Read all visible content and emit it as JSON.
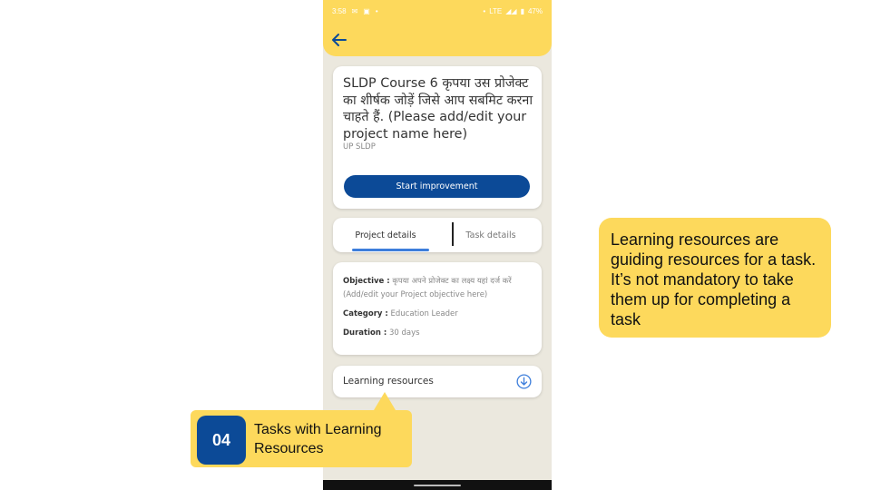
{
  "status_bar": {
    "time": "3:58",
    "battery": "47%",
    "network": "LTE"
  },
  "project": {
    "title": "SLDP Course 6 कृपया उस प्रोजेक्ट का शीर्षक जोड़ें जिसे आप सबमिट करना चाहते हैं. (Please add/edit your project name here)",
    "subtitle": "UP SLDP",
    "start_button": "Start improvement"
  },
  "tabs": {
    "project_details": "Project details",
    "task_details": "Task details"
  },
  "details": {
    "objective_label": "Objective :",
    "objective_value": " कृपया अपने प्रोजेक्ट का लक्ष्य यहां दर्ज करें (Add/edit your Project objective here)",
    "category_label": "Category :",
    "category_value": " Education Leader",
    "duration_label": "Duration :",
    "duration_value": " 30 days"
  },
  "learning_resources": {
    "label": "Learning resources"
  },
  "callout": {
    "text": "Learning resources are guiding resources for a task. It’s not mandatory to take them up for completing a task"
  },
  "step": {
    "number": "04",
    "text": "Tasks with Learning Resources"
  },
  "colors": {
    "accent_yellow": "#fdd95c",
    "primary_blue": "#0c4a97",
    "tab_underline": "#3d7edb",
    "background": "#ebe8de"
  }
}
